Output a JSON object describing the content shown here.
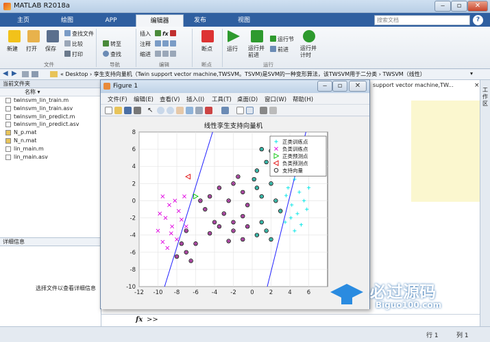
{
  "window": {
    "title": "MATLAB R2018a"
  },
  "ribbon_tabs": [
    "主页",
    "绘图",
    "APP",
    "编辑器",
    "发布",
    "视图"
  ],
  "search": {
    "placeholder": "搜索文档"
  },
  "ribbon": {
    "file_group": {
      "label": "文件",
      "new": "新建",
      "open": "打开",
      "save": "保存",
      "find_files": "查找文件",
      "compare": "比较",
      "print": "打印"
    },
    "nav_group": {
      "label": "导航",
      "goto": "转至",
      "find": "查找"
    },
    "edit_group": {
      "label": "编辑",
      "insert": "插入",
      "comment": "注释",
      "indent": "缩进"
    },
    "breakpoint_group": {
      "label": "断点",
      "breakpoints": "断点"
    },
    "run_group": {
      "label": "运行",
      "run": "运行",
      "run_advance": "运行并前进",
      "run_section": "运行节",
      "advance": "前进",
      "run_time": "运行并计时"
    }
  },
  "address": {
    "path": "« Desktop › 孪生支持向量机（Twin support vector machine,TWSVM。TSVM)是SVM的一种变形算法，该TWSVM用于二分类 › TWSVM（线性）"
  },
  "current_folder": {
    "header": "当前文件夹",
    "column": "名称",
    "files": [
      "twinsvm_lin_train.m",
      "twinsvm_lin_train.asv",
      "twinsvm_lin_predict.m",
      "twinsvm_lin_predict.asv",
      "N_p.mat",
      "N_n.mat",
      "lin_main.m",
      "lin_main.asv"
    ]
  },
  "details": {
    "header": "详细信息",
    "hint": "选择文件以查看详细信息"
  },
  "editor_tail": "support vector machine,TW...",
  "right_tab": "工作区",
  "command": {
    "fx": "fx",
    "prompt": ">>"
  },
  "status": {
    "row_label": "行",
    "row": "1",
    "col_label": "列",
    "col": "1"
  },
  "figure": {
    "title": "Figure 1",
    "menu": [
      "文件(F)",
      "编辑(E)",
      "查看(V)",
      "插入(I)",
      "工具(T)",
      "桌面(D)",
      "窗口(W)",
      "帮助(H)"
    ]
  },
  "watermark": {
    "brand": "必过源码",
    "site": "Biguo100.com"
  },
  "colors": {
    "tab_bar": "#2f5fa0",
    "positive": "#00e5e5",
    "negative": "#e000e0",
    "line": "#2020ff"
  },
  "chart_data": {
    "type": "scatter",
    "title": "线性孪生支持向量机",
    "xlim": [
      -12,
      8
    ],
    "ylim": [
      -10,
      8
    ],
    "xticks": [
      -12,
      -10,
      -8,
      -6,
      -4,
      -2,
      0,
      2,
      4,
      6
    ],
    "yticks": [
      -10,
      -8,
      -6,
      -4,
      -2,
      0,
      2,
      4,
      6,
      8
    ],
    "grid": true,
    "legend_position": "top-right",
    "legend": [
      "正类训练点",
      "负类训练点",
      "正类预测点",
      "负类预测点",
      "支持向量"
    ],
    "series": [
      {
        "name": "正类训练点",
        "marker": "+",
        "color": "#00e5e5",
        "points": [
          [
            3.2,
            4
          ],
          [
            4,
            3.5
          ],
          [
            4.5,
            2.5
          ],
          [
            5,
            1
          ],
          [
            3.8,
            1.5
          ],
          [
            4.2,
            -0.5
          ],
          [
            5.5,
            0
          ],
          [
            4.8,
            -1.5
          ],
          [
            3.5,
            -2.5
          ],
          [
            5.2,
            -2.8
          ],
          [
            4.5,
            -3.5
          ],
          [
            6,
            1.5
          ],
          [
            3.6,
            0.6
          ],
          [
            4.6,
            3.2
          ],
          [
            5.8,
            -1
          ],
          [
            4.1,
            -2
          ]
        ]
      },
      {
        "name": "负类训练点",
        "marker": "x",
        "color": "#e000e0",
        "points": [
          [
            -9.5,
            0.5
          ],
          [
            -8.8,
            -0.5
          ],
          [
            -9.2,
            -2
          ],
          [
            -8.5,
            -3
          ],
          [
            -10,
            -3.5
          ],
          [
            -8,
            -4.5
          ],
          [
            -9,
            -5.5
          ],
          [
            -7.2,
            0.5
          ],
          [
            -7.8,
            -1.2
          ],
          [
            -8.2,
            0
          ],
          [
            -9.8,
            -1.5
          ],
          [
            -7.5,
            -2.2
          ],
          [
            -8.6,
            -3.8
          ],
          [
            -9.5,
            -4.8
          ],
          [
            -7,
            -3
          ]
        ]
      },
      {
        "name": "正类预测点",
        "marker": "triangle-right",
        "color": "#00c000",
        "points": [
          [
            -6,
            0.5
          ]
        ]
      },
      {
        "name": "负类预测点",
        "marker": "triangle-left",
        "color": "#e00000",
        "points": [
          [
            -6.8,
            2.8
          ]
        ]
      },
      {
        "name": "支持向量",
        "marker": "circle",
        "color": "#000000",
        "points": [
          [
            1,
            6
          ],
          [
            2,
            5.8
          ],
          [
            1.5,
            4.5
          ],
          [
            0.5,
            3.5
          ],
          [
            -2,
            2
          ],
          [
            -1,
            1
          ],
          [
            0.5,
            1.5
          ],
          [
            1,
            0.5
          ],
          [
            -2.5,
            0
          ],
          [
            -0.5,
            -0.5
          ],
          [
            -1,
            -1.8
          ],
          [
            -2,
            -2.5
          ],
          [
            -3,
            -1.5
          ],
          [
            -4,
            -2.5
          ],
          [
            -3.5,
            -3
          ],
          [
            -2,
            -3.5
          ],
          [
            -0.5,
            -3
          ],
          [
            1,
            -2.5
          ],
          [
            1.5,
            -3.5
          ],
          [
            2,
            -4.5
          ],
          [
            0.5,
            -4
          ],
          [
            -1,
            -4.5
          ],
          [
            -2.5,
            -4.7
          ],
          [
            -4.5,
            -3.8
          ],
          [
            -5.5,
            0
          ],
          [
            -4.5,
            0.5
          ],
          [
            -3.5,
            1.5
          ],
          [
            -7,
            -3.5
          ],
          [
            -7.5,
            -5
          ],
          [
            -7,
            -6
          ],
          [
            -8,
            -6.5
          ],
          [
            -6.5,
            -7
          ],
          [
            -6,
            -5
          ],
          [
            3.2,
            5.5
          ],
          [
            2.5,
            0
          ],
          [
            0.2,
            2.5
          ],
          [
            -1.5,
            2.8
          ],
          [
            -5,
            -1
          ],
          [
            2,
            2
          ],
          [
            3,
            -1.2
          ]
        ]
      }
    ],
    "lines": [
      {
        "from": [
          -9.3,
          -10
        ],
        "to": [
          -4.2,
          8
        ]
      },
      {
        "from": [
          1.6,
          -10
        ],
        "to": [
          5.7,
          8
        ]
      }
    ]
  }
}
